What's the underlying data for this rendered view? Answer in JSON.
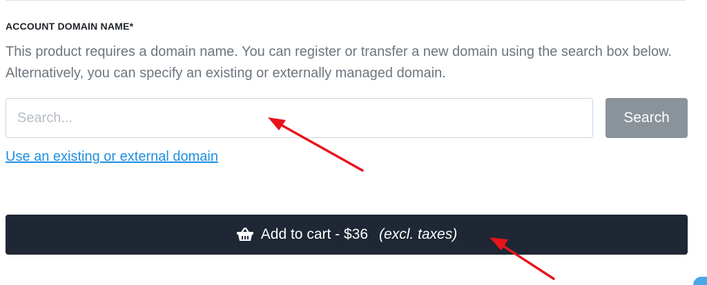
{
  "section": {
    "label": "ACCOUNT DOMAIN NAME*",
    "description": "This product requires a domain name. You can register or transfer a new domain using the search box below. Alternatively, you can specify an existing or externally managed domain."
  },
  "search": {
    "placeholder": "Search...",
    "value": "",
    "button_label": "Search"
  },
  "existing_domain_link": "Use an existing or external domain",
  "cart": {
    "icon": "basket-icon",
    "label": "Add to cart - $36",
    "note": "(excl. taxes)"
  },
  "colors": {
    "cart_button_bg": "#1e2733",
    "search_button_bg": "#8a939a",
    "link": "#1f8fe0",
    "annotation_arrow": "#e8141c"
  }
}
